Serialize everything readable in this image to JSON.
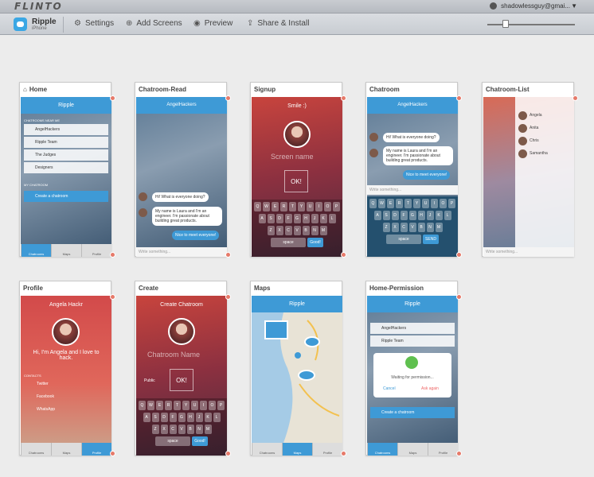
{
  "topbar": {
    "logo": "FLINTO",
    "user": "shadowlessguy@gmai..."
  },
  "toolbar": {
    "app_name": "Ripple",
    "app_sub": "iPhone",
    "buttons": [
      {
        "label": "Settings",
        "icon": "gear-icon"
      },
      {
        "label": "Add Screens",
        "icon": "plus-circle-icon"
      },
      {
        "label": "Preview",
        "icon": "eye-icon"
      },
      {
        "label": "Share & Install",
        "icon": "share-icon"
      }
    ]
  },
  "screens": [
    {
      "title": "Home"
    },
    {
      "title": "Chatroom-Read"
    },
    {
      "title": "Signup"
    },
    {
      "title": "Chatroom"
    },
    {
      "title": "Chatroom-List"
    },
    {
      "title": "Profile"
    },
    {
      "title": "Create"
    },
    {
      "title": "Maps"
    },
    {
      "title": "Home-Permission"
    }
  ],
  "content": {
    "home_header": "Ripple",
    "chatrooms_near": "CHATROOMS NEAR ME",
    "rooms": [
      "AngelHackers",
      "Ripple Team",
      "The Judges",
      "Designers"
    ],
    "my_chatroom": "MY CHATROOM",
    "create_chatroom": "Create a chatroom",
    "tabs": [
      "Chatrooms",
      "Maps",
      "Profile"
    ],
    "chat_room": "AngelHackers",
    "msg1": "Hi! What is everyone doing?",
    "msg2": "My name is Laura and I'm an engineer. I'm passionate about building great products.",
    "msg3": "Nice to meet everyone!",
    "write": "Write something...",
    "signup_title": "Smile :)",
    "screen_name": "Screen name",
    "ok": "OK!",
    "profile_name": "Angela Hackr",
    "profile_bio": "Hi, I'm Angela and I love to hack.",
    "contacts": "CONTACTS",
    "contact_items": [
      "Twitter",
      "Facebook",
      "WhatsApp"
    ],
    "create_title": "Create Chatroom",
    "chatroom_name": "Chatroom Name",
    "public": "Public",
    "space": "space",
    "good": "Good!",
    "send": "SEND",
    "maps_header": "Ripple",
    "waiting": "Waiting for permission...",
    "cancel": "Cancel",
    "ask_again": "Ask again",
    "list_names": [
      "Angela",
      "Anita",
      "Chris",
      "Samantha"
    ]
  },
  "colors": {
    "accent": "#3e9ad6",
    "dot": "#e67a6a"
  }
}
